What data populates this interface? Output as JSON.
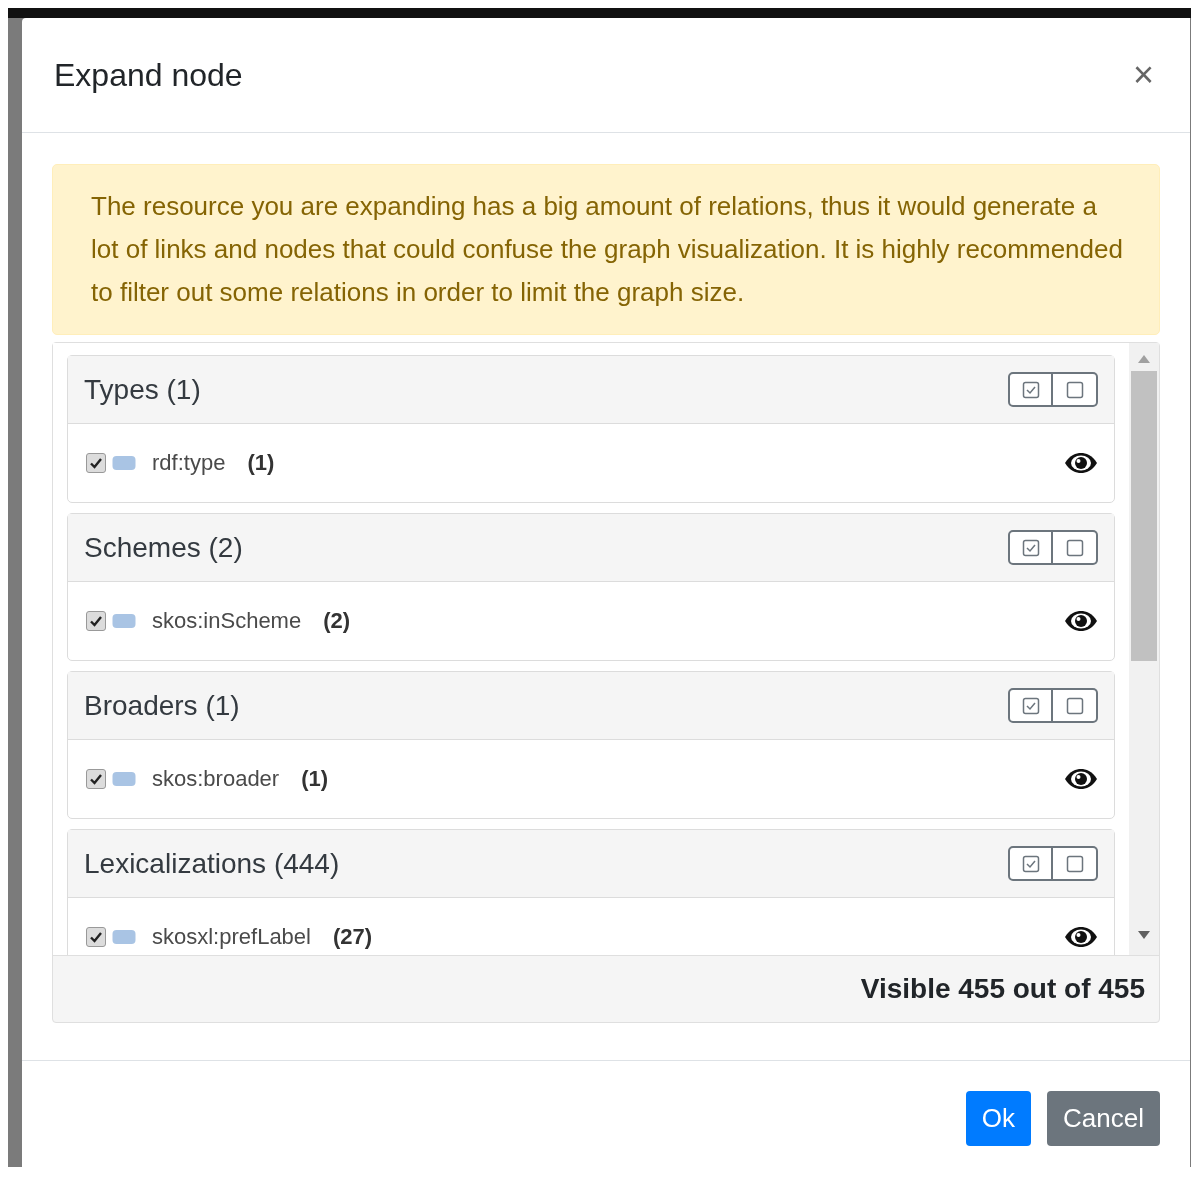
{
  "dialog": {
    "title": "Expand node",
    "close": "×"
  },
  "alert": "The resource you are expanding has a big amount of relations, thus it would generate a lot of links and nodes that could confuse the graph visualization. It is highly recommended to filter out some relations in order to limit the graph size.",
  "groups": [
    {
      "title": "Types (1)",
      "relations": [
        {
          "name": "rdf:type",
          "count": "(1)",
          "checked": true
        }
      ]
    },
    {
      "title": "Schemes (2)",
      "relations": [
        {
          "name": "skos:inScheme",
          "count": "(2)",
          "checked": true
        }
      ]
    },
    {
      "title": "Broaders (1)",
      "relations": [
        {
          "name": "skos:broader",
          "count": "(1)",
          "checked": true
        }
      ]
    },
    {
      "title": "Lexicalizations (444)",
      "relations": [
        {
          "name": "skosxl:prefLabel",
          "count": "(27)",
          "checked": true
        }
      ]
    }
  ],
  "summary": "Visible 455 out of 455",
  "buttons": [
    {
      "label": "Ok",
      "kind": "primary"
    },
    {
      "label": "Cancel",
      "kind": "secondary"
    }
  ]
}
